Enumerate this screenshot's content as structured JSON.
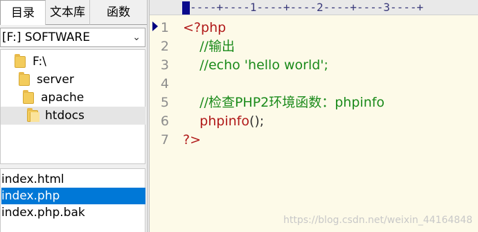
{
  "tabs": [
    {
      "label": "目录"
    },
    {
      "label": "文本库"
    },
    {
      "label": "函数"
    }
  ],
  "drive_select": {
    "value": "[F:] SOFTWARE"
  },
  "tree": [
    {
      "label": "F:\\"
    },
    {
      "label": "server"
    },
    {
      "label": "apache"
    },
    {
      "label": "htdocs"
    }
  ],
  "files": [
    {
      "label": "index.html"
    },
    {
      "label": "index.php"
    },
    {
      "label": "index.php.bak"
    }
  ],
  "ruler": {
    "text": "----+----1----+----2----+----3----+"
  },
  "line_numbers": [
    "1",
    "2",
    "3",
    "4",
    "5",
    "6",
    "7"
  ],
  "code": {
    "l1": "<?php",
    "l2": "    //输出",
    "l3": "    //echo 'hello world';",
    "l4": "",
    "l5": "    //检查PHP2环境函数：phpinfo",
    "l6_fn": "    phpinfo",
    "l6_rest": "();",
    "l7": "?>"
  },
  "watermark": "https://blog.csdn.net/weixin_44164848",
  "colors": {
    "selection": "#0078d7",
    "code_bg": "#fdfae8",
    "keyword": "#b01818",
    "comment": "#1a8a1a"
  }
}
